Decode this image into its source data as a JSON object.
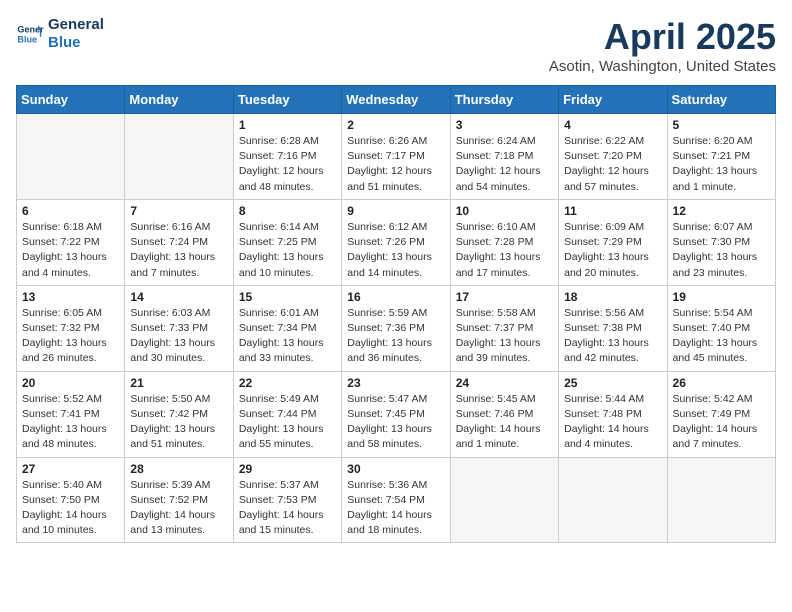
{
  "logo": {
    "line1": "General",
    "line2": "Blue"
  },
  "title": "April 2025",
  "subtitle": "Asotin, Washington, United States",
  "weekdays": [
    "Sunday",
    "Monday",
    "Tuesday",
    "Wednesday",
    "Thursday",
    "Friday",
    "Saturday"
  ],
  "weeks": [
    [
      {
        "day": "",
        "info": ""
      },
      {
        "day": "",
        "info": ""
      },
      {
        "day": "1",
        "info": "Sunrise: 6:28 AM\nSunset: 7:16 PM\nDaylight: 12 hours and 48 minutes."
      },
      {
        "day": "2",
        "info": "Sunrise: 6:26 AM\nSunset: 7:17 PM\nDaylight: 12 hours and 51 minutes."
      },
      {
        "day": "3",
        "info": "Sunrise: 6:24 AM\nSunset: 7:18 PM\nDaylight: 12 hours and 54 minutes."
      },
      {
        "day": "4",
        "info": "Sunrise: 6:22 AM\nSunset: 7:20 PM\nDaylight: 12 hours and 57 minutes."
      },
      {
        "day": "5",
        "info": "Sunrise: 6:20 AM\nSunset: 7:21 PM\nDaylight: 13 hours and 1 minute."
      }
    ],
    [
      {
        "day": "6",
        "info": "Sunrise: 6:18 AM\nSunset: 7:22 PM\nDaylight: 13 hours and 4 minutes."
      },
      {
        "day": "7",
        "info": "Sunrise: 6:16 AM\nSunset: 7:24 PM\nDaylight: 13 hours and 7 minutes."
      },
      {
        "day": "8",
        "info": "Sunrise: 6:14 AM\nSunset: 7:25 PM\nDaylight: 13 hours and 10 minutes."
      },
      {
        "day": "9",
        "info": "Sunrise: 6:12 AM\nSunset: 7:26 PM\nDaylight: 13 hours and 14 minutes."
      },
      {
        "day": "10",
        "info": "Sunrise: 6:10 AM\nSunset: 7:28 PM\nDaylight: 13 hours and 17 minutes."
      },
      {
        "day": "11",
        "info": "Sunrise: 6:09 AM\nSunset: 7:29 PM\nDaylight: 13 hours and 20 minutes."
      },
      {
        "day": "12",
        "info": "Sunrise: 6:07 AM\nSunset: 7:30 PM\nDaylight: 13 hours and 23 minutes."
      }
    ],
    [
      {
        "day": "13",
        "info": "Sunrise: 6:05 AM\nSunset: 7:32 PM\nDaylight: 13 hours and 26 minutes."
      },
      {
        "day": "14",
        "info": "Sunrise: 6:03 AM\nSunset: 7:33 PM\nDaylight: 13 hours and 30 minutes."
      },
      {
        "day": "15",
        "info": "Sunrise: 6:01 AM\nSunset: 7:34 PM\nDaylight: 13 hours and 33 minutes."
      },
      {
        "day": "16",
        "info": "Sunrise: 5:59 AM\nSunset: 7:36 PM\nDaylight: 13 hours and 36 minutes."
      },
      {
        "day": "17",
        "info": "Sunrise: 5:58 AM\nSunset: 7:37 PM\nDaylight: 13 hours and 39 minutes."
      },
      {
        "day": "18",
        "info": "Sunrise: 5:56 AM\nSunset: 7:38 PM\nDaylight: 13 hours and 42 minutes."
      },
      {
        "day": "19",
        "info": "Sunrise: 5:54 AM\nSunset: 7:40 PM\nDaylight: 13 hours and 45 minutes."
      }
    ],
    [
      {
        "day": "20",
        "info": "Sunrise: 5:52 AM\nSunset: 7:41 PM\nDaylight: 13 hours and 48 minutes."
      },
      {
        "day": "21",
        "info": "Sunrise: 5:50 AM\nSunset: 7:42 PM\nDaylight: 13 hours and 51 minutes."
      },
      {
        "day": "22",
        "info": "Sunrise: 5:49 AM\nSunset: 7:44 PM\nDaylight: 13 hours and 55 minutes."
      },
      {
        "day": "23",
        "info": "Sunrise: 5:47 AM\nSunset: 7:45 PM\nDaylight: 13 hours and 58 minutes."
      },
      {
        "day": "24",
        "info": "Sunrise: 5:45 AM\nSunset: 7:46 PM\nDaylight: 14 hours and 1 minute."
      },
      {
        "day": "25",
        "info": "Sunrise: 5:44 AM\nSunset: 7:48 PM\nDaylight: 14 hours and 4 minutes."
      },
      {
        "day": "26",
        "info": "Sunrise: 5:42 AM\nSunset: 7:49 PM\nDaylight: 14 hours and 7 minutes."
      }
    ],
    [
      {
        "day": "27",
        "info": "Sunrise: 5:40 AM\nSunset: 7:50 PM\nDaylight: 14 hours and 10 minutes."
      },
      {
        "day": "28",
        "info": "Sunrise: 5:39 AM\nSunset: 7:52 PM\nDaylight: 14 hours and 13 minutes."
      },
      {
        "day": "29",
        "info": "Sunrise: 5:37 AM\nSunset: 7:53 PM\nDaylight: 14 hours and 15 minutes."
      },
      {
        "day": "30",
        "info": "Sunrise: 5:36 AM\nSunset: 7:54 PM\nDaylight: 14 hours and 18 minutes."
      },
      {
        "day": "",
        "info": ""
      },
      {
        "day": "",
        "info": ""
      },
      {
        "day": "",
        "info": ""
      }
    ]
  ]
}
